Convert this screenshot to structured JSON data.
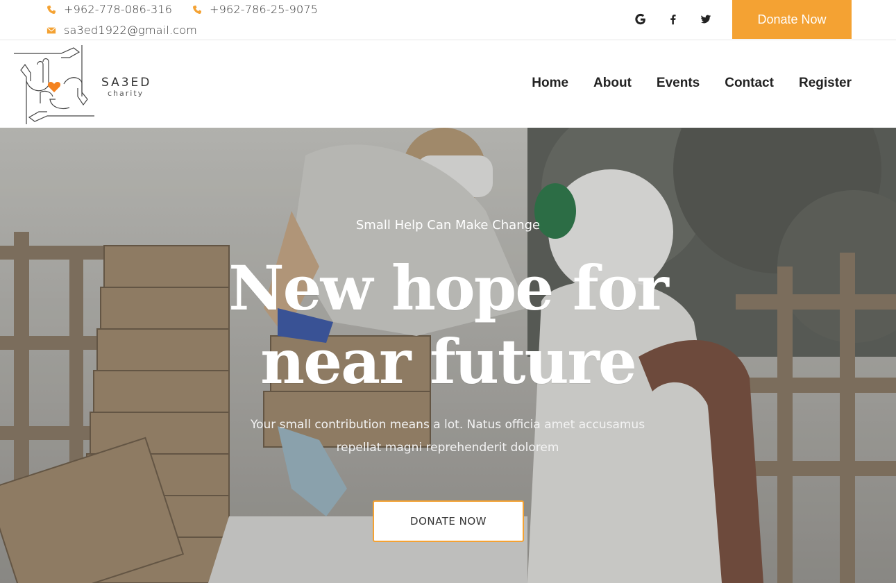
{
  "topbar": {
    "phone1": "+962-778-086-316",
    "phone2": "+962-786-25-9075",
    "email": "sa3ed1922@gmail.com",
    "social": [
      "google-icon",
      "facebook-icon",
      "twitter-icon"
    ],
    "donate_label": "Donate Now"
  },
  "brand": {
    "name": "SA3ED",
    "sub": "charity"
  },
  "nav": {
    "items": [
      "Home",
      "About",
      "Events",
      "Contact",
      "Register"
    ]
  },
  "hero": {
    "kicker": "Small Help Can Make Change",
    "headline_line1": "New hope for",
    "headline_line2": "near future",
    "description": "Your small contribution means a lot. Natus officia amet accusamus repellat magni reprehenderit dolorem",
    "cta_label": "DONATE NOW"
  },
  "colors": {
    "accent": "#f4a233",
    "heart": "#f4821f"
  }
}
